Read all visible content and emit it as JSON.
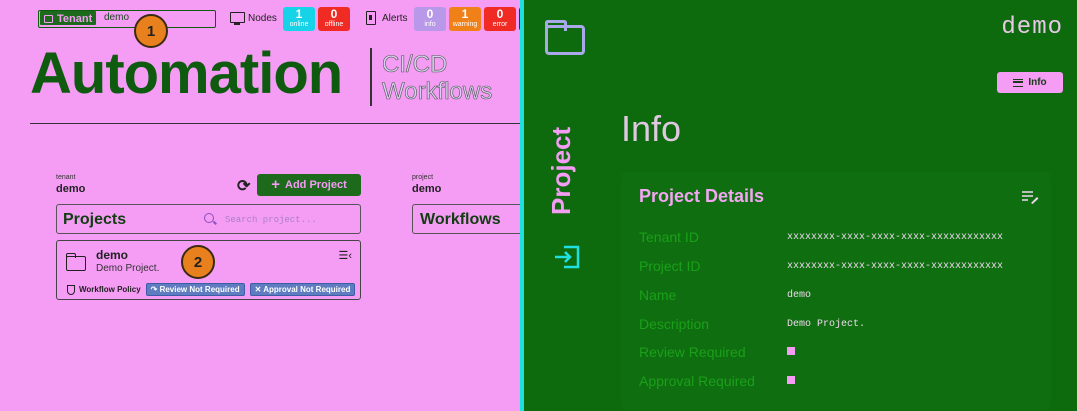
{
  "topbar": {
    "tenant_label": "Tenant",
    "tenant_value": "demo",
    "nodes_label": "Nodes",
    "alerts_label": "Alerts",
    "badges": {
      "online": {
        "count": "1",
        "label": "online",
        "color": "#17d3e8"
      },
      "offline": {
        "count": "0",
        "label": "offline",
        "color": "#ef2b24"
      },
      "info": {
        "count": "0",
        "label": "info",
        "color": "#b898e8"
      },
      "warning": {
        "count": "1",
        "label": "warning",
        "color": "#f08018"
      },
      "error": {
        "count": "0",
        "label": "error",
        "color": "#ef2b24"
      }
    }
  },
  "markers": [
    "1",
    "2"
  ],
  "header": {
    "title": "Automation",
    "subtitle_line1": "CI/CD",
    "subtitle_line2": "Workflows"
  },
  "projects_panel": {
    "tenant_caption": "tenant",
    "tenant_value": "demo",
    "add_label": "Add Project",
    "title": "Projects",
    "search_placeholder": "Search project...",
    "items": [
      {
        "name": "demo",
        "description": "Demo Project.",
        "policy_label": "Workflow Policy",
        "review_tag": "Review Not Required",
        "approval_tag": "Approval Not Required"
      }
    ]
  },
  "workflows_panel": {
    "project_caption": "project",
    "project_value": "demo",
    "title": "Workflows"
  },
  "right_panel": {
    "vertical_label": "Project",
    "project_title": "demo",
    "info_button": "Info",
    "heading": "Info",
    "details_title": "Project Details",
    "rows": [
      {
        "label": "Tenant ID",
        "value": "xxxxxxxx-xxxx-xxxx-xxxx-xxxxxxxxxxxx"
      },
      {
        "label": "Project ID",
        "value": "xxxxxxxx-xxxx-xxxx-xxxx-xxxxxxxxxxxx"
      },
      {
        "label": "Name",
        "value": "demo"
      },
      {
        "label": "Description",
        "value": "Demo Project."
      },
      {
        "label": "Review Required",
        "value": ""
      },
      {
        "label": "Approval Required",
        "value": ""
      }
    ],
    "colors": {
      "panel": "#0d6a0d",
      "accent": "#f59cf5"
    }
  }
}
